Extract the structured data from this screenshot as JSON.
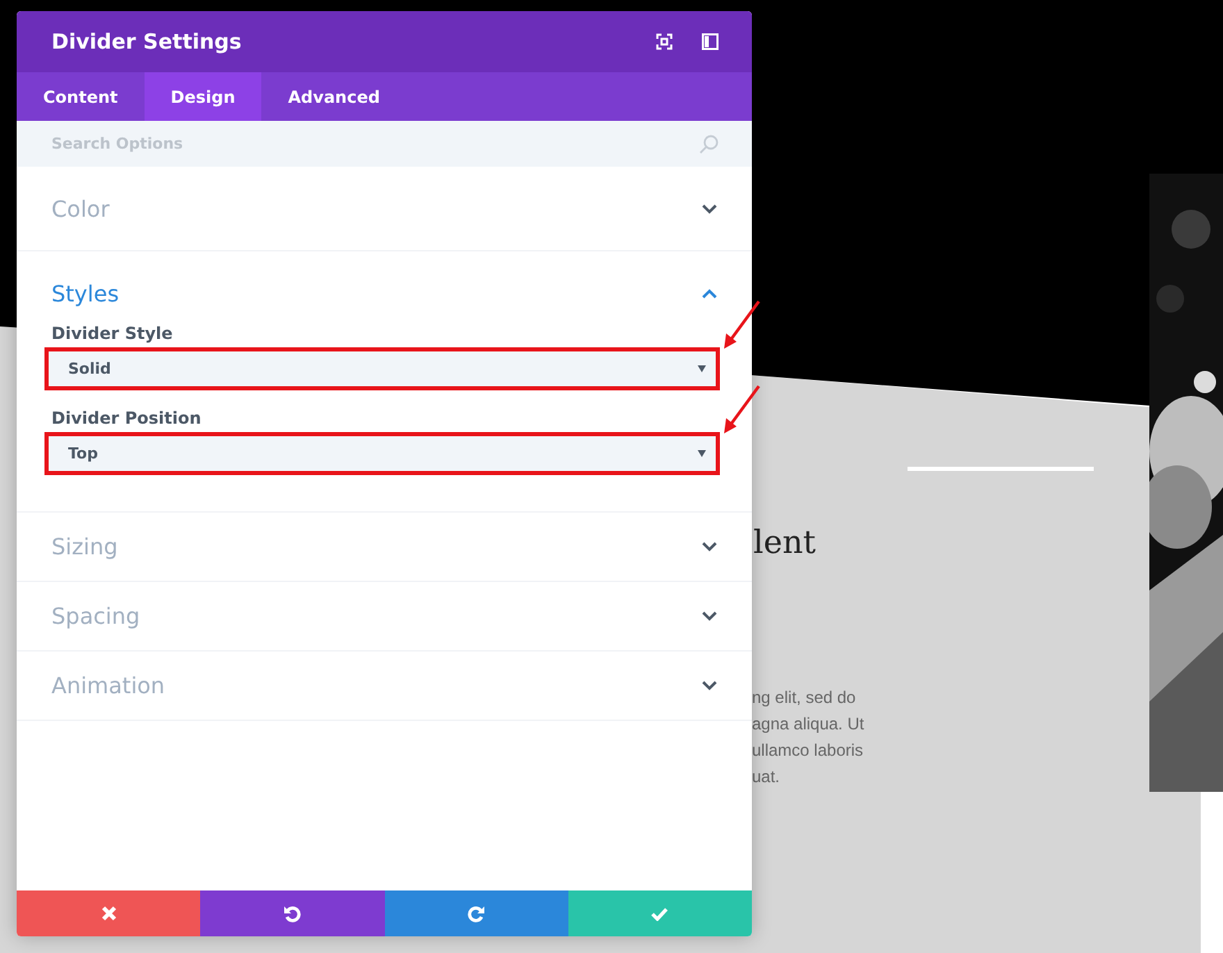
{
  "background_page": {
    "heading": "lent",
    "paragraph_lines": [
      "ng elit, sed do",
      "agna aliqua. Ut",
      "ullamco laboris",
      "uat."
    ]
  },
  "modal": {
    "title": "Divider Settings",
    "tabs": [
      {
        "label": "Content",
        "selected": false
      },
      {
        "label": "Design",
        "selected": true
      },
      {
        "label": "Advanced",
        "selected": false
      }
    ],
    "search": {
      "placeholder": "Search Options"
    },
    "sections": [
      {
        "title": "Color",
        "expanded": false
      },
      {
        "title": "Styles",
        "expanded": true,
        "fields": [
          {
            "label": "Divider Style",
            "value": "Solid",
            "highlighted": true
          },
          {
            "label": "Divider Position",
            "value": "Top",
            "highlighted": true
          }
        ]
      },
      {
        "title": "Sizing",
        "expanded": false
      },
      {
        "title": "Spacing",
        "expanded": false
      },
      {
        "title": "Animation",
        "expanded": false
      }
    ],
    "footer_buttons": [
      {
        "kind": "cancel"
      },
      {
        "kind": "undo"
      },
      {
        "kind": "redo"
      },
      {
        "kind": "save"
      }
    ]
  }
}
